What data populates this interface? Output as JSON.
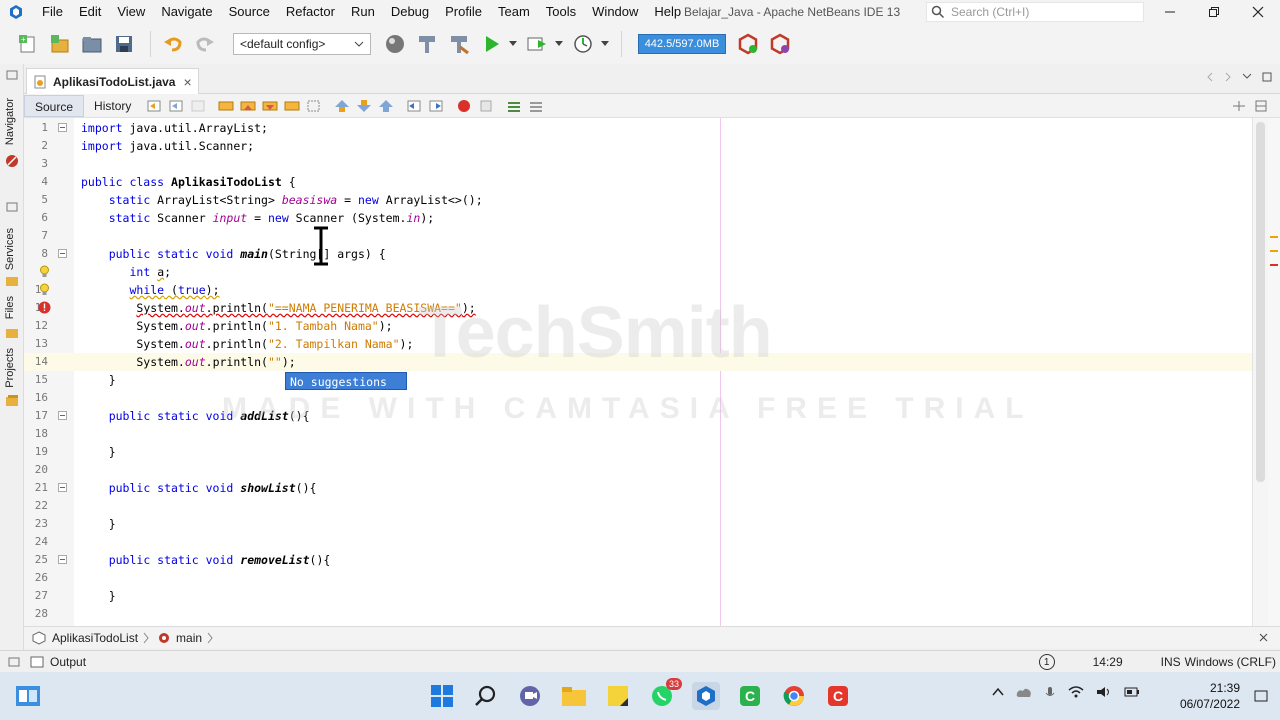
{
  "menu": [
    "File",
    "Edit",
    "View",
    "Navigate",
    "Source",
    "Refactor",
    "Run",
    "Debug",
    "Profile",
    "Team",
    "Tools",
    "Window",
    "Help"
  ],
  "window_title": "Belajar_Java - Apache NetBeans IDE 13",
  "search": {
    "placeholder": "Search (Ctrl+I)"
  },
  "toolbar": {
    "config": "<default config>",
    "memory": "442.5/597.0MB"
  },
  "side_tabs": [
    "Navigator",
    "Services",
    "Files",
    "Projects"
  ],
  "editor_tab": {
    "label": "AplikasiTodoList.java",
    "close": "×"
  },
  "editor_toolbar": {
    "source": "Source",
    "history": "History"
  },
  "lines": [
    "1",
    "2",
    "3",
    "4",
    "5",
    "6",
    "7",
    "8",
    "9",
    "10",
    "11",
    "12",
    "13",
    "14",
    "15",
    "16",
    "17",
    "18",
    "19",
    "20",
    "21",
    "22",
    "23",
    "24",
    "25",
    "26",
    "27",
    "28"
  ],
  "suggestion": "No suggestions",
  "watermark": {
    "logo": "TechSmith",
    "text": "MADE WITH CAMTASIA FREE TRIAL"
  },
  "breadcrumb": {
    "class": "AplikasiTodoList",
    "method": "main"
  },
  "status": {
    "output": "Output",
    "notifications": "1",
    "position": "14:29",
    "mode": "INS",
    "line_ending": "Windows (CRLF)"
  },
  "taskbar": {
    "time": "21:39",
    "date": "06/07/2022",
    "whatsapp_badge": "33"
  },
  "colors": {
    "keyword": "#0000e6",
    "field": "#a40095",
    "string": "#ce7b00",
    "memory_bar": "#3b8edb"
  }
}
